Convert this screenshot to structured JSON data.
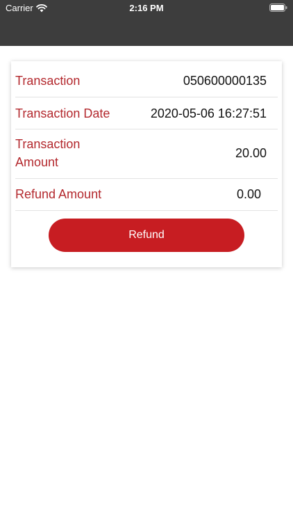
{
  "status_bar": {
    "carrier": "Carrier",
    "time": "2:16 PM",
    "icons": [
      "wifi-icon",
      "battery-icon"
    ]
  },
  "transaction": {
    "rows": [
      {
        "label": "Transaction",
        "value": "050600000135"
      },
      {
        "label": "Transaction Date",
        "value": "2020-05-06 16:27:51"
      },
      {
        "label_line1": "Transaction",
        "label_line2": "Amount",
        "value": "20.00"
      },
      {
        "label": "Refund Amount",
        "value": "0.00"
      }
    ],
    "refund_button_label": "Refund"
  },
  "colors": {
    "header_bg": "#3d3d3d",
    "label_red": "#b3282d",
    "button_red": "#c71d22"
  }
}
